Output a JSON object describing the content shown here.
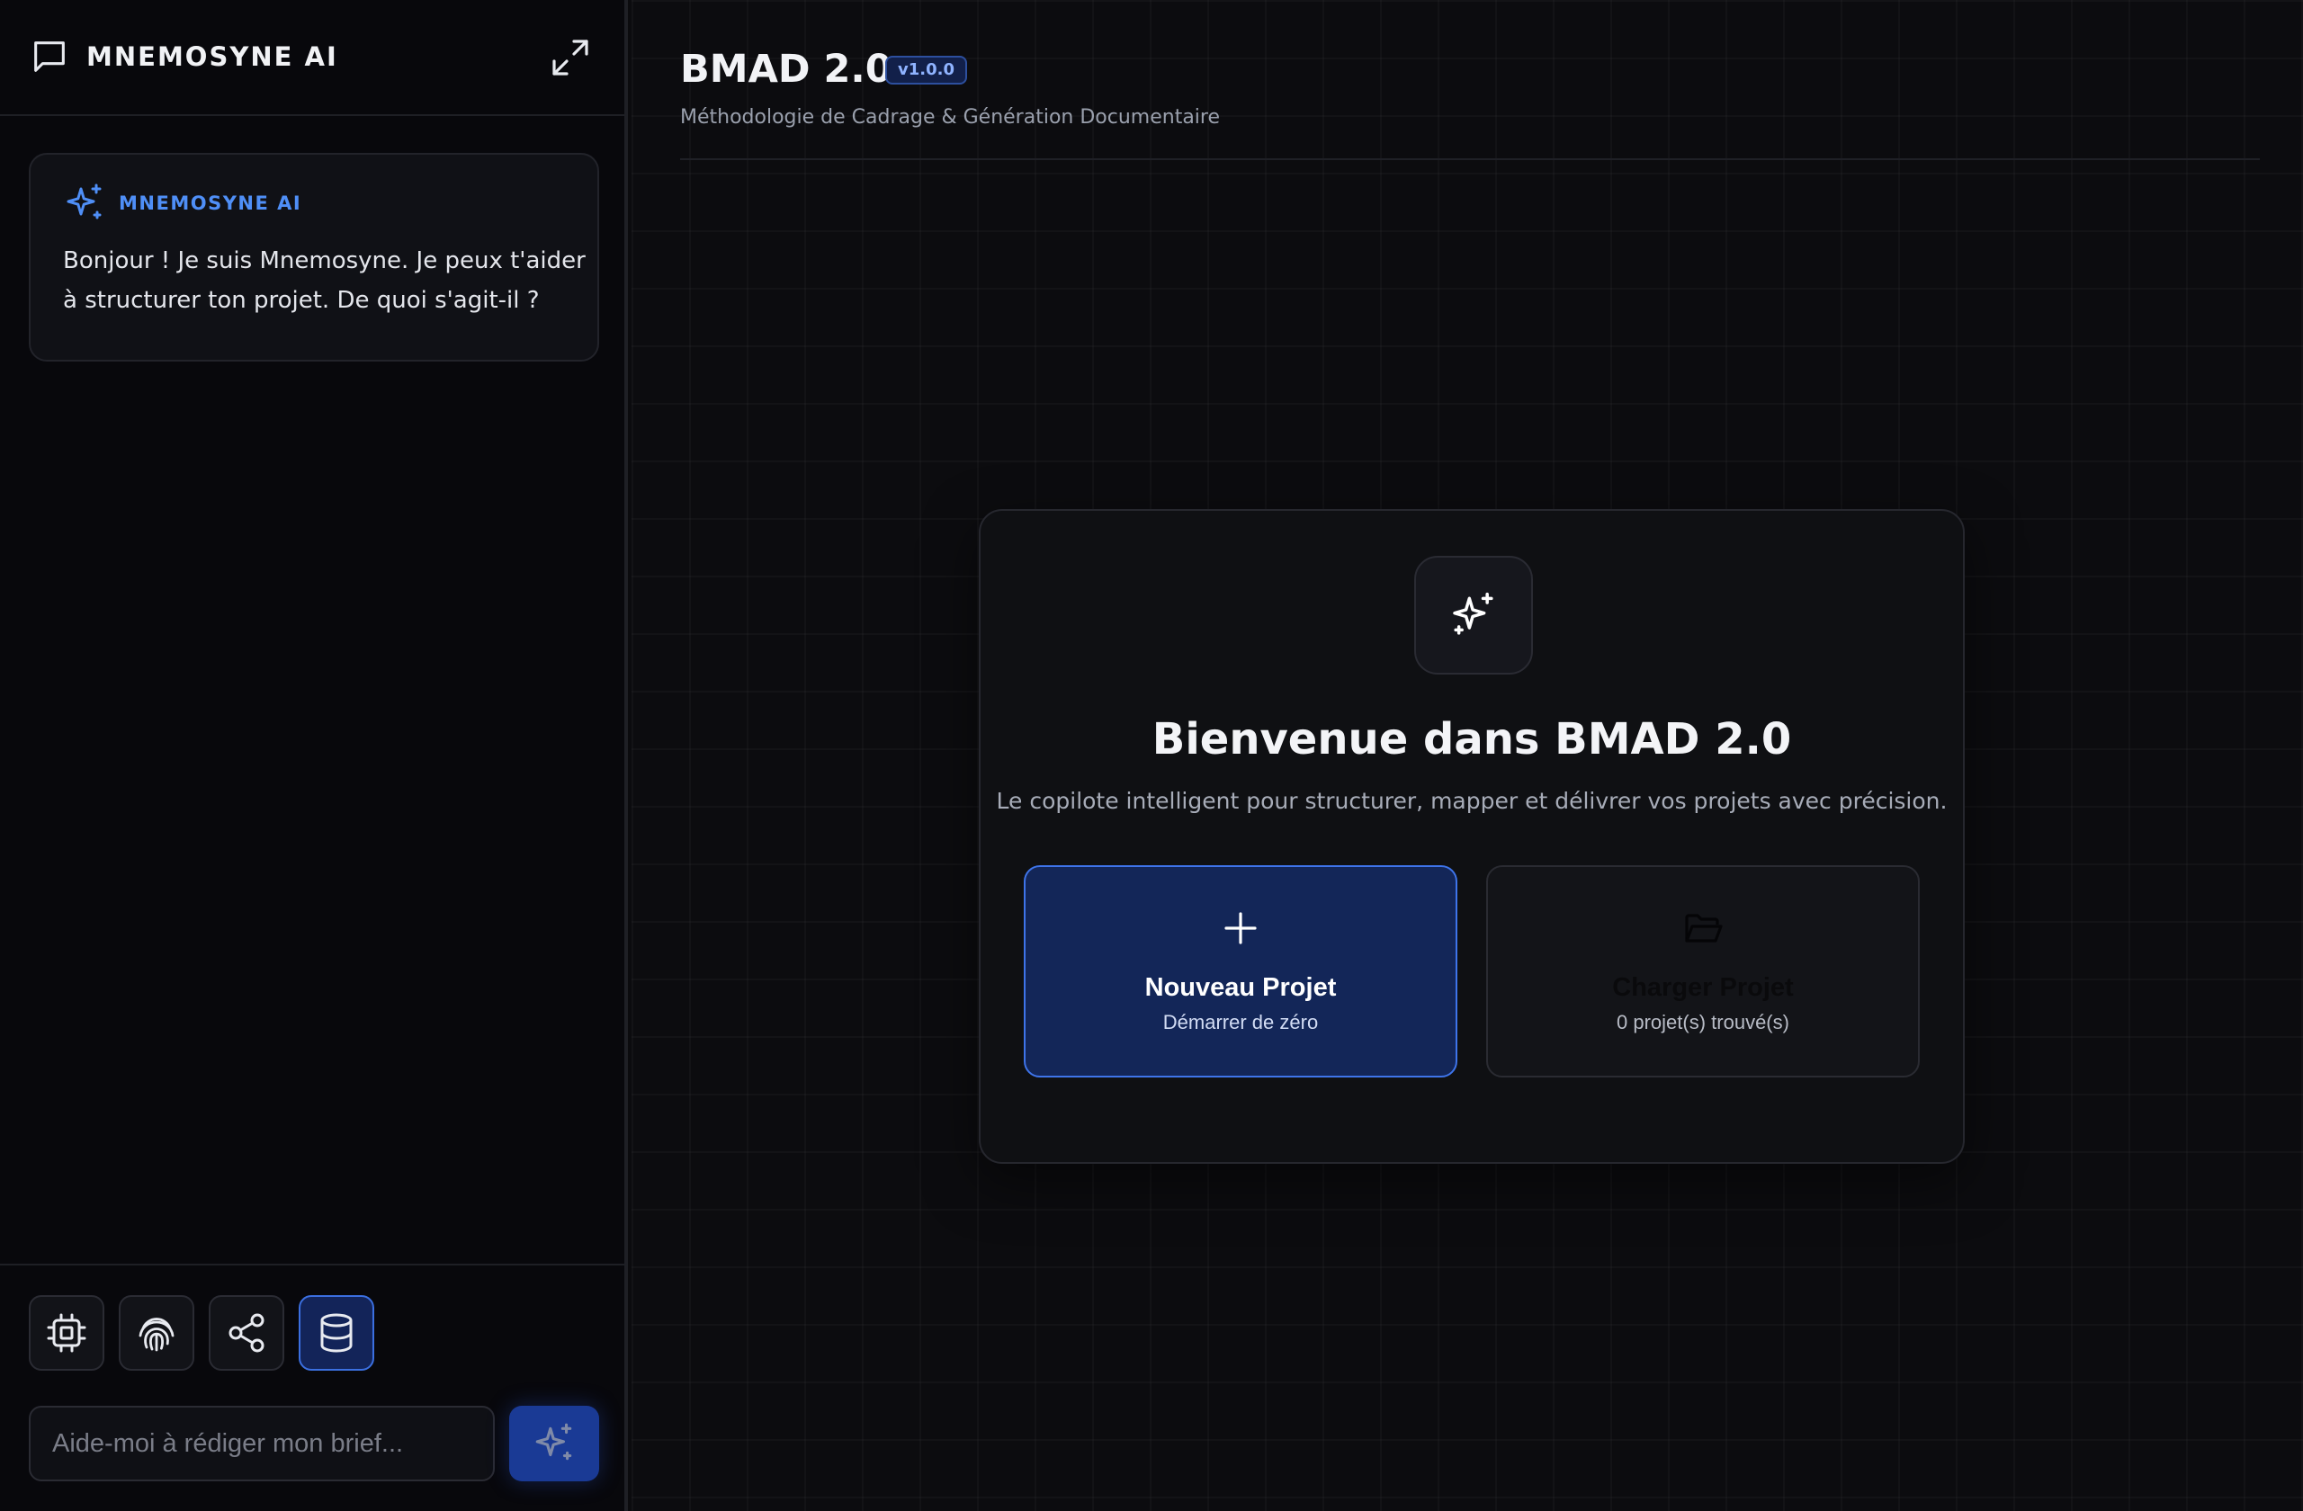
{
  "sidebar": {
    "title": "MNEMOSYNE AI",
    "message": {
      "author": "MNEMOSYNE AI",
      "text": "Bonjour ! Je suis Mnemosyne. Je peux t'aider à structurer ton projet. De quoi s'agit-il ?"
    },
    "tools": [
      {
        "icon": "cpu-chip-icon",
        "active": false
      },
      {
        "icon": "fingerprint-icon",
        "active": false
      },
      {
        "icon": "share-nodes-icon",
        "active": false
      },
      {
        "icon": "database-icon",
        "active": true
      }
    ],
    "input": {
      "placeholder": "Aide-moi à rédiger mon brief...",
      "value": ""
    },
    "send_icon": "sparkles-icon"
  },
  "main": {
    "title": "BMAD 2.0",
    "version": "v1.0.0",
    "subtitle": "Méthodologie de Cadrage & Génération Documentaire",
    "welcome": {
      "title": "Bienvenue dans BMAD 2.0",
      "description": "Le copilote intelligent pour structurer, mapper et délivrer vos projets avec précision.",
      "new_project": {
        "title": "Nouveau Projet",
        "subtitle": "Démarrer de zéro",
        "icon": "plus-icon"
      },
      "load_project": {
        "title": "Charger Projet",
        "subtitle": "0 projet(s) trouvé(s)",
        "icon": "folder-open-icon"
      }
    }
  },
  "colors": {
    "background": "#0c0c0f",
    "sidebar_background": "#08080c",
    "accent": "#4f8ff7",
    "primary_button": "#132658",
    "primary_border": "#3e74ea"
  }
}
